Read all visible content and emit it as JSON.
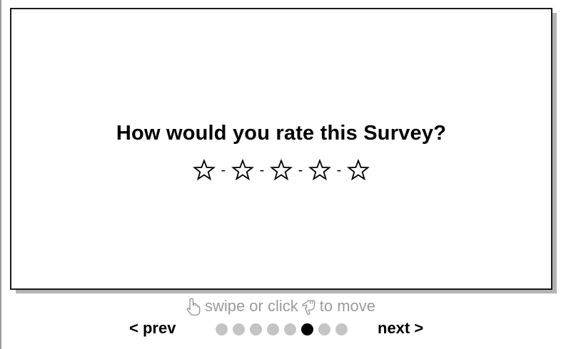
{
  "slide": {
    "question": "How would you rate this Survey?",
    "separator": "-",
    "rating": {
      "max": 5,
      "selected": 0
    }
  },
  "hint": {
    "swipe_text": "swipe or click",
    "move_text": "to move"
  },
  "navigation": {
    "prev_label": "< prev",
    "next_label": "next >",
    "page_count": 8,
    "current_page": 6
  },
  "colors": {
    "dot_inactive": "#c4c4c4",
    "dot_active": "#000000",
    "hint_text": "#9a9a9a"
  }
}
